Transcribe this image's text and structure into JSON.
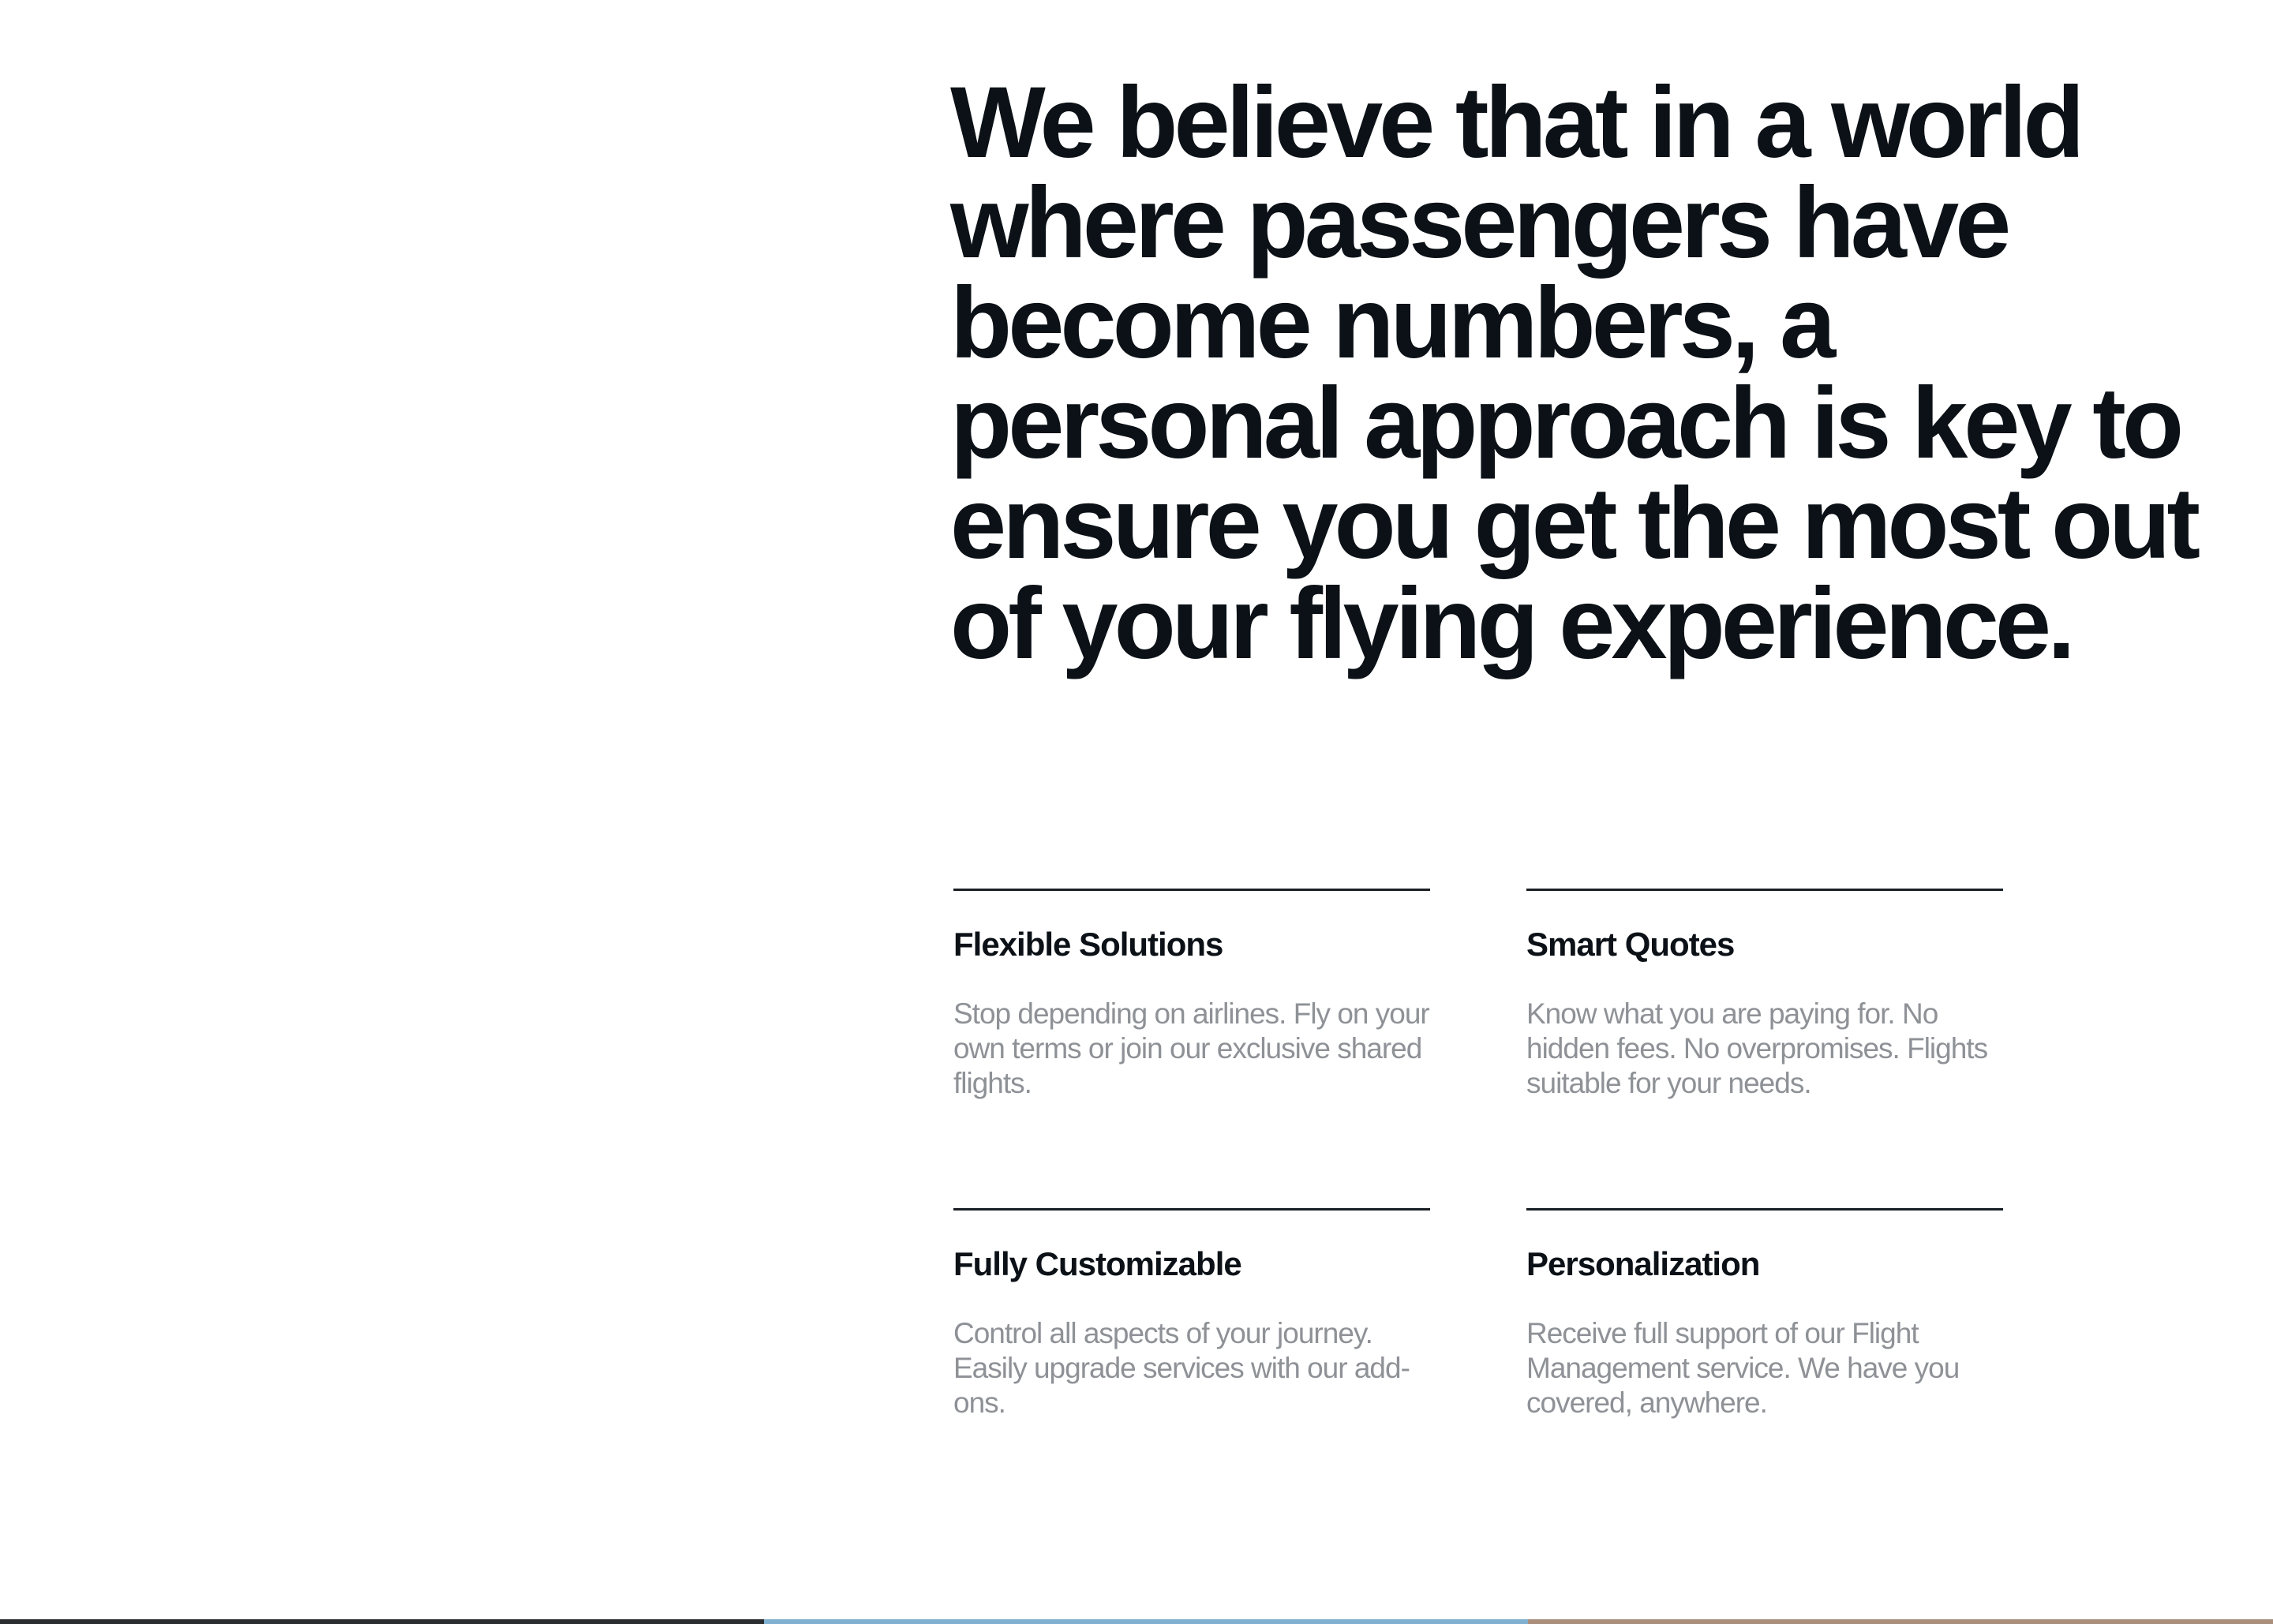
{
  "headline": "We believe that in a world where passengers have become numbers, a personal approach is key to ensure you get the most out of your flying experience.",
  "features": [
    {
      "title": "Flexible Solutions",
      "description": "Stop depending on airlines. Fly on your own terms or join our exclusive shared flights."
    },
    {
      "title": "Smart Quotes",
      "description": "Know what you are paying for. No hidden fees. No overpromises. Flights suitable for your needs."
    },
    {
      "title": "Fully Customizable",
      "description": "Control all aspects of your journey. Easily upgrade services with our add-ons."
    },
    {
      "title": "Personalization",
      "description": "Receive full support of our Flight Management service. We have you covered, anywhere."
    }
  ],
  "colors": {
    "heading": "#0b1116",
    "body_text": "#8e9196",
    "rule": "#1a1f24",
    "background": "#ffffff"
  }
}
